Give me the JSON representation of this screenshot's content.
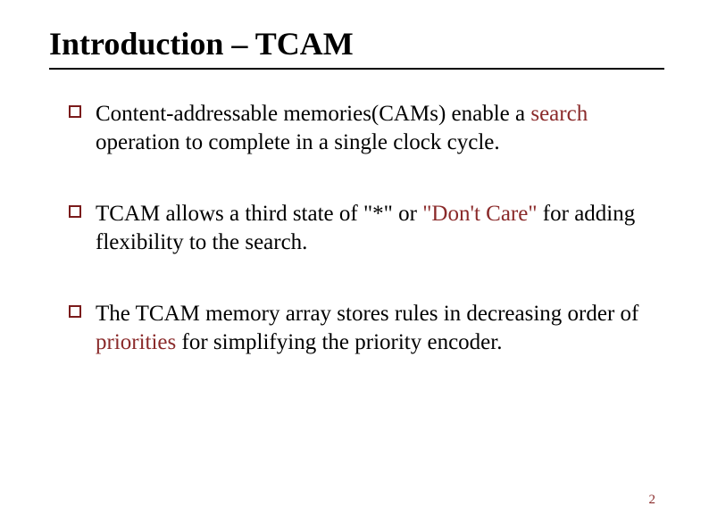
{
  "title": "Introduction – TCAM",
  "bullets": [
    {
      "pre": "Content-addressable memories(CAMs) enable a ",
      "accent": "search",
      "post": " operation to complete in a single clock cycle."
    },
    {
      "pre": "TCAM allows a third state of \"*\" or ",
      "accent": "\"Don't Care\"",
      "post": " for adding flexibility to the search."
    },
    {
      "pre": "The TCAM memory array stores rules in decreasing order of ",
      "accent": "priorities",
      "post": " for simplifying the priority encoder."
    }
  ],
  "page_number": "2"
}
